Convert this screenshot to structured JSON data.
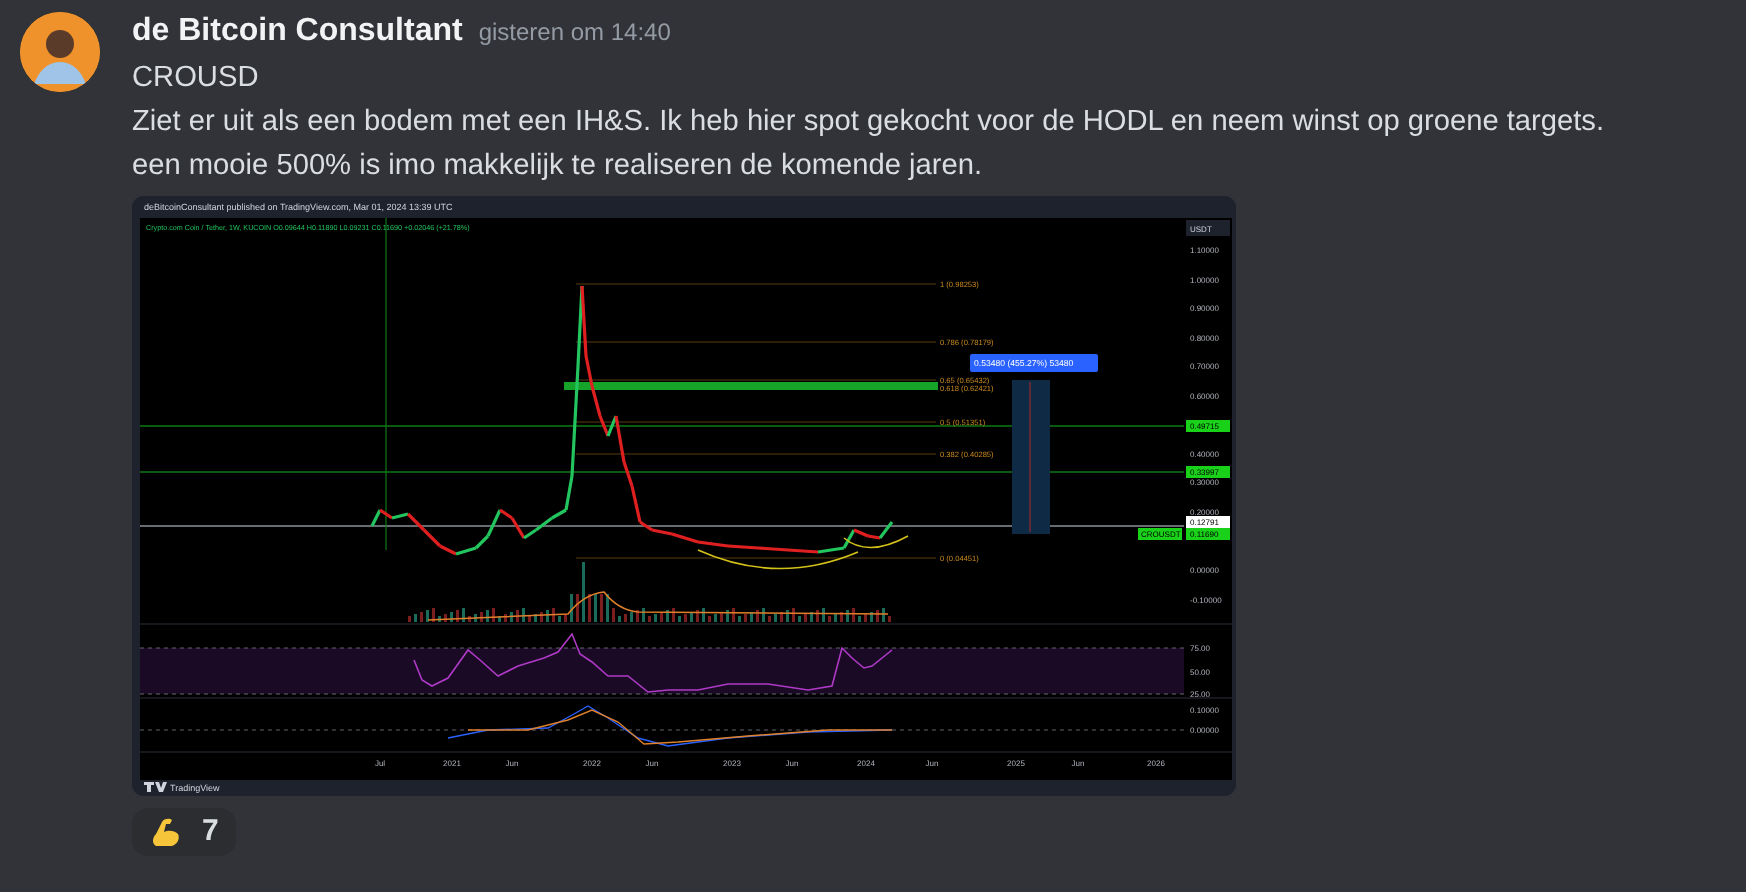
{
  "message": {
    "author": "de Bitcoin Consultant",
    "timestamp": "gisteren om 14:40",
    "lines": [
      "CROUSD",
      "Ziet er uit als een bodem met een IH&S. Ik heb hier spot gekocht voor de HODL en neem winst op groene targets.",
      "een mooie 500% is imo makkelijk te realiseren de komende jaren."
    ]
  },
  "attachment": {
    "header": "deBitcoinConsultant published on TradingView.com, Mar 01, 2024 13:39 UTC",
    "legend": "Crypto.com Coin / Tether, 1W, KUCOIN O0.09644 H0.11890 L0.09231 C0.11690 +0.02046 (+21.78%)",
    "y_axis_unit": "USDT",
    "y_ticks": [
      "1.10000",
      "1.00000",
      "0.90000",
      "0.80000",
      "0.70000",
      "0.60000",
      "0.40000",
      "0.30000",
      "0.20000",
      "0.00000",
      "-0.10000"
    ],
    "fib_levels": [
      "1 (0.98253)",
      "0.786 (0.78179)",
      "0.65 (0.65432)",
      "0.618 (0.62421)",
      "0.5 (0.51351)",
      "0.382 (0.40285)",
      "0 (0.04451)"
    ],
    "price_tags": [
      {
        "label": "0.49715",
        "kind": "target"
      },
      {
        "label": "0.33997",
        "kind": "target"
      },
      {
        "label": "0.12791",
        "kind": "line"
      },
      {
        "label": "0.11690",
        "kind": "target"
      }
    ],
    "symbol_tag": "CROUSDT",
    "measure_label": "0.53480 (455.27%) 53480",
    "rsi_ticks": [
      "75.00",
      "50.00",
      "25.00"
    ],
    "macd_ticks": [
      "0.10000",
      "0.00000"
    ],
    "x_ticks": [
      "Jul",
      "2021",
      "Jun",
      "2022",
      "Jun",
      "2023",
      "Jun",
      "2024",
      "Jun",
      "2025",
      "Jun",
      "2026"
    ],
    "footer": "TradingView"
  },
  "reactions": [
    {
      "count": "7",
      "selected": false
    }
  ]
}
